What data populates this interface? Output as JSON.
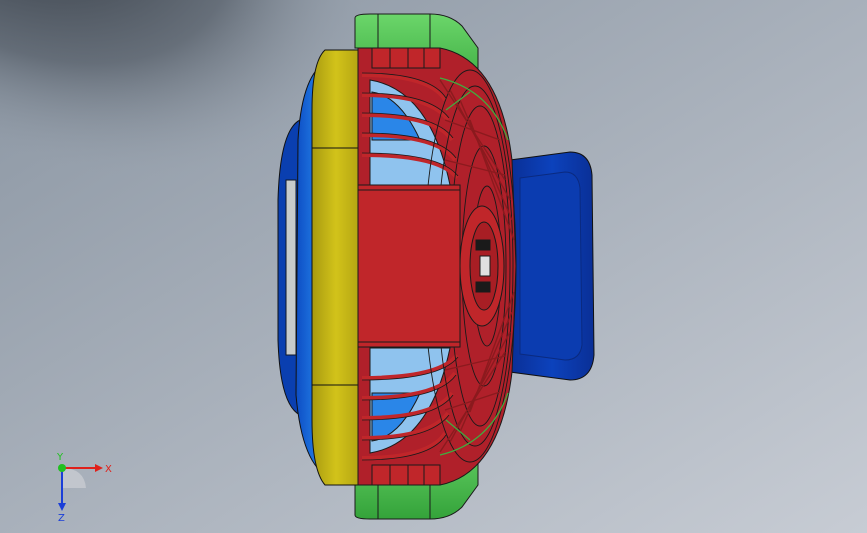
{
  "viewport": {
    "background_top": "#8e98a4",
    "background_bottom": "#c4cad3",
    "shadow_color": "#2a2f36"
  },
  "model": {
    "colors": {
      "rear_housing_blue": "#0a3fb0",
      "rear_rim_blue": "#1f7ce8",
      "yellow_ring": "#c7b814",
      "red_guard": "#c0262a",
      "green_stand": "#4cc34a",
      "handle_blue": "#0a36a8",
      "blade_light_blue": "#8fc3ee",
      "outline": "#1a1a1a"
    }
  },
  "triad": {
    "x_label": "X",
    "y_label": "Y",
    "z_label": "Z",
    "x_color": "#e0201a",
    "y_color": "#20c020",
    "z_color": "#1a3ed8"
  }
}
